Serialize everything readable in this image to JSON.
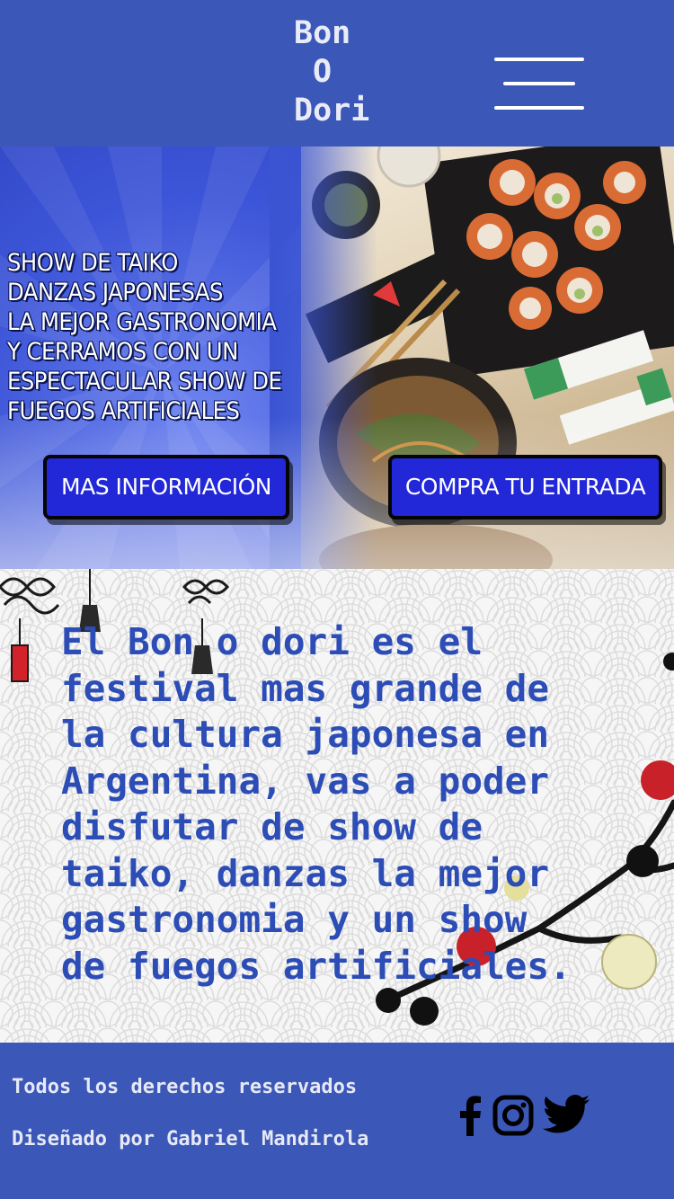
{
  "header": {
    "logo_line1": "Bon",
    "logo_line2": "O",
    "logo_line3": "Dori",
    "menu_icon": "hamburger-menu-icon"
  },
  "banner": {
    "lines": [
      "SHOW DE TAIKO",
      "DANZAS JAPONESAS",
      "LA MEJOR GASTRONOMIA",
      "Y CERRAMOS CON UN",
      "ESPECTACULAR SHOW DE",
      "FUEGOS ARTIFICIALES"
    ],
    "info_button": "MAS INFORMACIÓN",
    "buy_button": "COMPRA TU ENTRADA"
  },
  "content": {
    "lines": [
      "El Bon o dori es el",
      "festival mas grande de",
      "la cultura japonesa en",
      "Argentina, vas a poder",
      "disfutar de show de",
      "taiko, danzas la mejor",
      "gastronomia y un show",
      "de fuegos artificiales."
    ]
  },
  "footer": {
    "rights": "Todos los derechos reservados",
    "designer": "Diseñado por Gabriel Mandirola",
    "social_icons": [
      "facebook-icon",
      "instagram-icon",
      "twitter-icon"
    ]
  },
  "colors": {
    "primary": "#3b57b8",
    "text_blue": "#2c4cb6",
    "button": "#2227d8"
  }
}
